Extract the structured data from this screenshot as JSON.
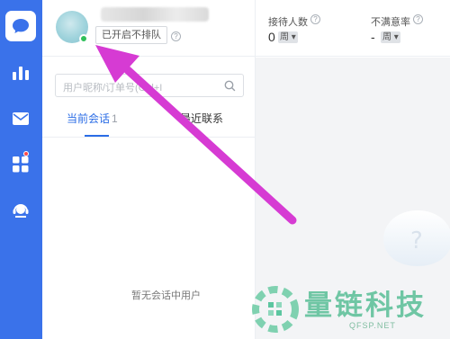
{
  "sidebar": {
    "items": [
      {
        "icon": "chat-icon",
        "active": true
      },
      {
        "icon": "bar-chart-icon",
        "active": false
      },
      {
        "icon": "mail-icon",
        "active": false
      },
      {
        "icon": "apps-grid-icon",
        "active": false,
        "badge": true
      },
      {
        "icon": "customer-service-icon",
        "active": false
      }
    ]
  },
  "header": {
    "status_label": "已开启不排队",
    "help_glyph": "?",
    "stats": [
      {
        "label": "接待人数",
        "value": "0",
        "unit": "周"
      },
      {
        "label": "不满意率",
        "value": "-",
        "unit": "周"
      }
    ]
  },
  "search": {
    "placeholder": "用户昵称/订单号(Ctrl+I"
  },
  "tabs": [
    {
      "label": "当前会话",
      "count_label": "1",
      "active": true
    },
    {
      "label": "最近联系",
      "active": false
    }
  ],
  "list": {
    "empty_text": "暂无会话中用户"
  },
  "watermark": {
    "title": "量链科技",
    "subtitle": "QFSP.NET"
  },
  "colors": {
    "sidebar_bg": "#3a72ea",
    "accent": "#2b6de6",
    "online": "#2fbf5a",
    "annotation_arrow": "#d63bd3",
    "watermark": "#6fc6a4"
  }
}
